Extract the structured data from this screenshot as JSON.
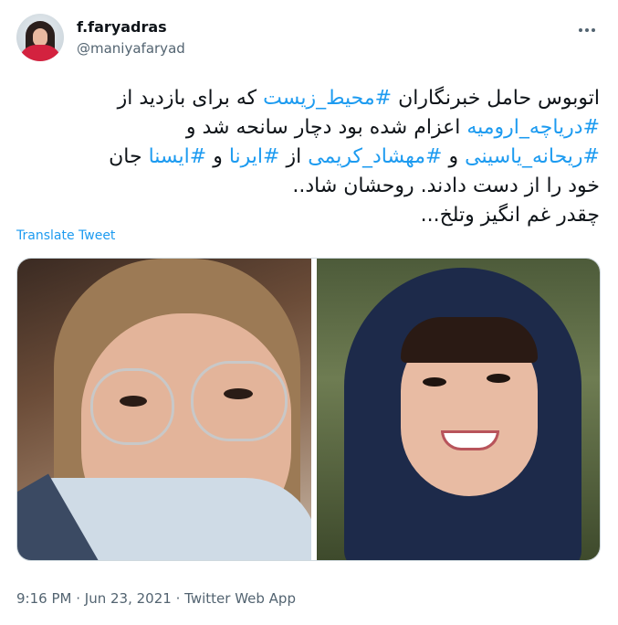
{
  "author": {
    "display_name": "f.faryadras",
    "handle": "@maniyafaryad"
  },
  "tweet": {
    "lines": [
      [
        {
          "t": "اتوبوس حامل خبرنگاران ",
          "tag": false
        },
        {
          "t": "#محیط_زیست",
          "tag": true
        },
        {
          "t": " که برای بازدید از",
          "tag": false
        }
      ],
      [
        {
          "t": "#دریاچه_ارومیه",
          "tag": true
        },
        {
          "t": " اعزام شده بود دچار سانحه شد و",
          "tag": false
        }
      ],
      [
        {
          "t": "#ریحانه_یاسینی",
          "tag": true
        },
        {
          "t": " و ",
          "tag": false
        },
        {
          "t": "#مهشاد_کریمی",
          "tag": true
        },
        {
          "t": " از ",
          "tag": false
        },
        {
          "t": "#ایرنا",
          "tag": true
        },
        {
          "t": " و ",
          "tag": false
        },
        {
          "t": "#ایسنا",
          "tag": true
        },
        {
          "t": " جان",
          "tag": false
        }
      ],
      [
        {
          "t": "خود را از دست دادند. روحشان شاد..",
          "tag": false
        }
      ],
      [
        {
          "t": "چقدر غم انگیز وتلخ...",
          "tag": false
        }
      ]
    ],
    "translate_label": "Translate Tweet"
  },
  "meta": {
    "time": "9:16 PM",
    "separator": "·",
    "date": "Jun 23, 2021",
    "source": "Twitter Web App"
  },
  "icons": {
    "more": "more-options-icon",
    "avatar": "profile-avatar"
  },
  "colors": {
    "link": "#1d9bf0",
    "text": "#0f1419",
    "secondary": "#536471"
  }
}
